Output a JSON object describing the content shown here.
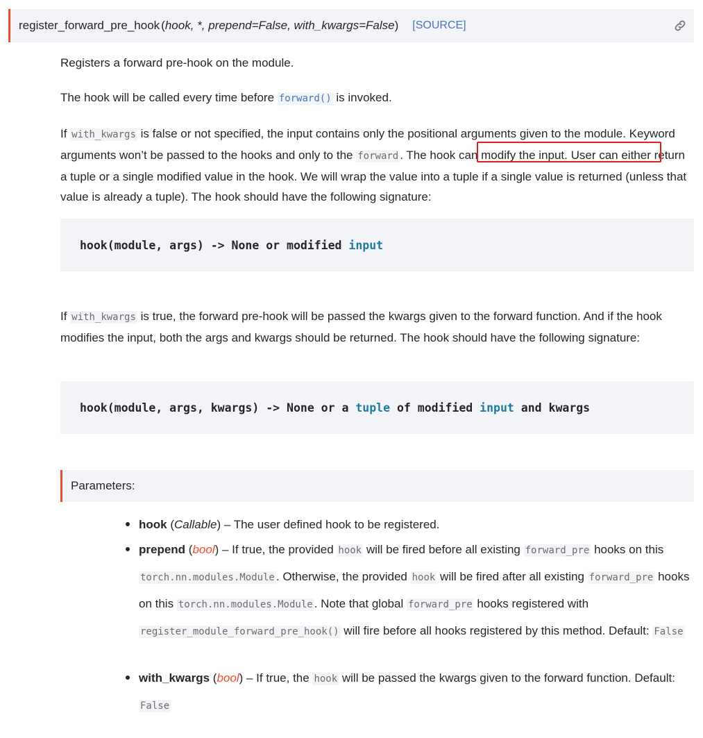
{
  "signature": {
    "name": "register_forward_pre_hook",
    "open_paren": "(",
    "params": "hook, *, prepend=False, with_kwargs=False",
    "close_paren": ")",
    "source_label": "[SOURCE]"
  },
  "p1": "Registers a forward pre-hook on the module.",
  "p2": {
    "before": "The hook will be called every time before ",
    "code": "forward()",
    "after": " is invoked."
  },
  "p3": {
    "t1": "If ",
    "c1": "with_kwargs",
    "t2": " is false or not specified, the input contains only the positional arguments given to the module. Keyword arguments won’t be passed to the hooks and only to the ",
    "c2": "forward",
    "t3": ". The hook can modify the input. User can either return a tuple or a single modified value in the hook. We will wrap the value into a tuple if a single value is returned (unless that value is already a tuple). The hook should have the following signature:"
  },
  "code1": {
    "a": "hook(module, args) -> None or modified ",
    "b": "input"
  },
  "p4": {
    "t1": "If ",
    "c1": "with_kwargs",
    "t2": " is true, the forward pre-hook will be passed the kwargs given to the forward function. And if the hook modifies the input, both the args and kwargs should be returned. The hook should have the following signature:"
  },
  "code2": {
    "a": "hook(module, args, kwargs) -> None or a ",
    "b": "tuple",
    "c": " of modified ",
    "d": "input",
    "e": " and kwargs"
  },
  "params_label": "Parameters:",
  "params": {
    "hook": {
      "name": "hook",
      "type": "Callable",
      "desc": " – The user defined hook to be registered."
    },
    "prepend": {
      "name": "prepend",
      "type": "bool",
      "t1": " – If true, the provided ",
      "c1": "hook",
      "t2": " will be fired before all existing ",
      "c2": "forward_pre",
      "t3": " hooks on this ",
      "c3": "torch.nn.modules.Module",
      "t4": ". Otherwise, the provided ",
      "c4": "hook",
      "t5": " will be fired after all existing ",
      "c5": "forward_pre",
      "t6": " hooks on this ",
      "c6": "torch.nn.modules.Module",
      "t7": ". Note that global ",
      "c7": "forward_pre",
      "t8": " hooks registered with ",
      "c8": "register_module_forward_pre_hook()",
      "t9": " will fire before all hooks registered by this method. Default: ",
      "c9": "False"
    },
    "with_kwargs": {
      "name": "with_kwargs",
      "type": "bool",
      "t1": " – If true, the ",
      "c1": "hook",
      "t2": " will be passed the kwargs given to the forward function. Default: ",
      "c2": "False"
    }
  },
  "colors": {
    "accent": "#ee4c2c",
    "link": "#4874b9",
    "highlight_box": "#e02020",
    "code_bg": "#f3f4f7"
  },
  "icons": [
    "link-icon",
    "bullet-icon"
  ]
}
